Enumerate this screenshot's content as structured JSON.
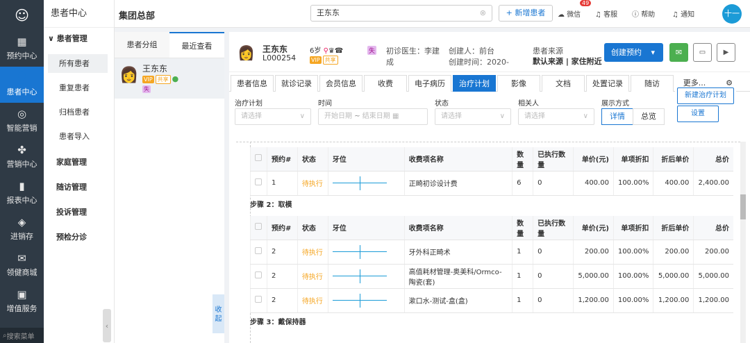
{
  "rail": {
    "items": [
      {
        "label": "预约中心",
        "icon": "calendar-icon",
        "glyph": "▦"
      },
      {
        "label": "患者中心",
        "icon": "user-icon",
        "glyph": "👤"
      },
      {
        "label": "智能营销",
        "icon": "target-icon",
        "glyph": "◎"
      },
      {
        "label": "营销中心",
        "icon": "fan-icon",
        "glyph": "✤"
      },
      {
        "label": "报表中心",
        "icon": "bar-chart-icon",
        "glyph": "▮"
      },
      {
        "label": "进销存",
        "icon": "layers-icon",
        "glyph": "◈"
      },
      {
        "label": "领健商城",
        "icon": "mail-icon",
        "glyph": "✉"
      },
      {
        "label": "增值服务",
        "icon": "grid-icon",
        "glyph": "▣"
      }
    ],
    "search": "搜索菜单",
    "active_color": "#1976d2"
  },
  "subnav": {
    "title": "患者中心",
    "group1": "患者管理",
    "subs": [
      "所有患者",
      "重复患者",
      "归档患者",
      "患者导入"
    ],
    "groups": [
      "家庭管理",
      "随访管理",
      "投诉管理",
      "预检分诊"
    ]
  },
  "topbar": {
    "org": "集团总部",
    "search_value": "王东东",
    "new_patient": "+ 新增患者",
    "wechat": "微信",
    "wechat_badge": "49",
    "service": "客服",
    "help": "帮助",
    "notice": "通知",
    "avatar": "十一"
  },
  "plist": {
    "tab1": "患者分组",
    "tab2": "最近查看",
    "name": "王东东",
    "vip": "VIP",
    "share": "共享",
    "lost": "失"
  },
  "patient": {
    "name": "王东东",
    "id": "L000254",
    "age": "6岁",
    "vip": "VIP",
    "share": "共享",
    "lost": "失",
    "doctor": "初诊医生：李建成",
    "creator": "创建人：前台",
    "created_time": "创建时间：2020-",
    "source_label": "患者来源",
    "source_value": "默认来源 | 家住附近",
    "book_btn": "创建预约"
  },
  "tabs": [
    "患者信息",
    "就诊记录",
    "会员信息",
    "收费",
    "电子病历",
    "治疗计划",
    "影像",
    "文档",
    "处置记录",
    "随访",
    "更多..."
  ],
  "active_tab": "治疗计划",
  "filters": {
    "plan_label": "治疗计划",
    "plan_ph": "请选择",
    "time_label": "时间",
    "start_ph": "开始日期",
    "sep": "~",
    "end_ph": "结束日期",
    "status_label": "状态",
    "status_ph": "请选择",
    "person_label": "相关人",
    "person_ph": "请选择",
    "mode_label": "展示方式",
    "mode_detail": "详情",
    "mode_overview": "总览",
    "new_plan": "新建治疗计划",
    "settings": "设置"
  },
  "table": {
    "headers": [
      "预约#",
      "状态",
      "牙位",
      "收费项名称",
      "数量",
      "已执行数量",
      "单价(元)",
      "单项折扣",
      "折后单价",
      "总价"
    ]
  },
  "steps": [
    {
      "label": "",
      "rows": [
        {
          "no": "1",
          "status": "待执行",
          "name": "正畸初诊设计费",
          "qty": "6",
          "done": "0",
          "price": "400.00",
          "disc": "100.00%",
          "after": "400.00",
          "total": "2,400.00"
        }
      ]
    },
    {
      "label": "步骤 2：取模",
      "rows": [
        {
          "no": "2",
          "status": "待执行",
          "name": "牙外科正畸术",
          "qty": "1",
          "done": "0",
          "price": "200.00",
          "disc": "100.00%",
          "after": "200.00",
          "total": "200.00"
        },
        {
          "no": "2",
          "status": "待执行",
          "name": "高值耗材管理-奥美科/Ormco-陶瓷(套)",
          "qty": "1",
          "done": "0",
          "price": "5,000.00",
          "disc": "100.00%",
          "after": "5,000.00",
          "total": "5,000.00"
        },
        {
          "no": "2",
          "status": "待执行",
          "name": "漱口水-测试-盒(盒)",
          "qty": "1",
          "done": "0",
          "price": "1,200.00",
          "disc": "100.00%",
          "after": "1,200.00",
          "total": "1,200.00"
        }
      ]
    },
    {
      "label": "步骤 3：戴保持器",
      "rows": []
    }
  ],
  "fold": "收起"
}
